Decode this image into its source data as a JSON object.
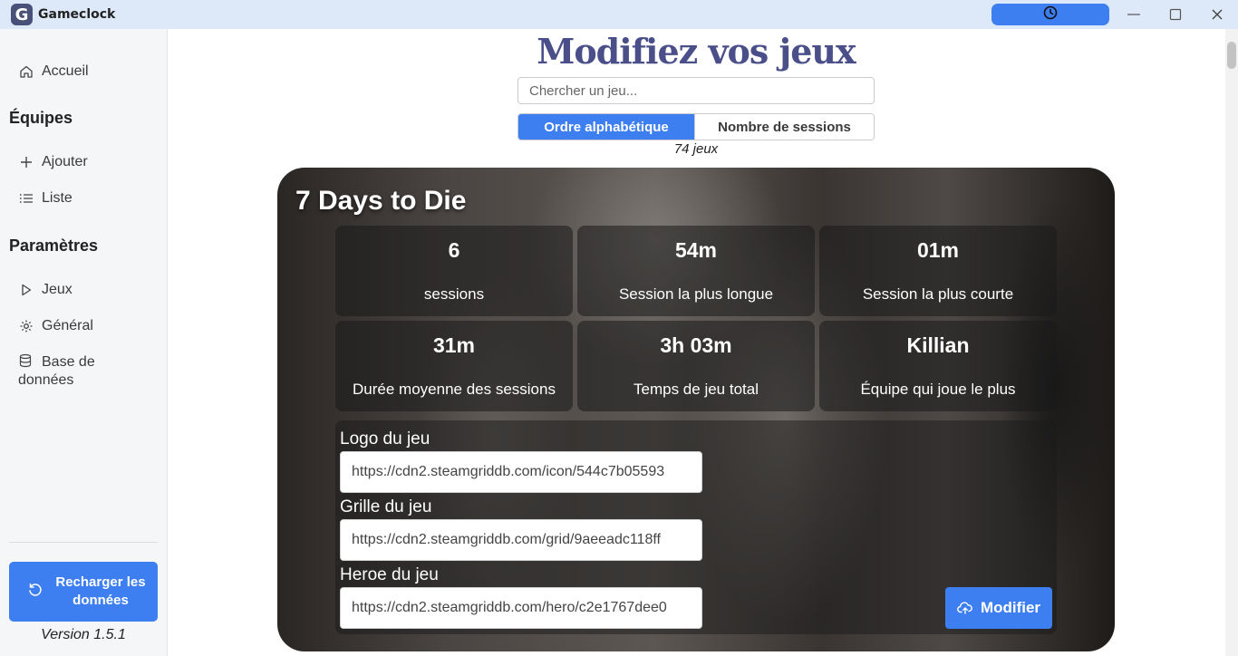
{
  "app": {
    "logo_letter": "G",
    "title": "Gameclock"
  },
  "window": {
    "minimize": "—",
    "maximize": "☐",
    "close": "✕"
  },
  "sidebar": {
    "home": "Accueil",
    "teams_title": "Équipes",
    "add": "Ajouter",
    "list": "Liste",
    "settings_title": "Paramètres",
    "games": "Jeux",
    "general": "Général",
    "database": "Base de données",
    "reload": "Recharger les données",
    "version": "Version 1.5.1"
  },
  "main": {
    "title": "Modifiez vos jeux",
    "search_placeholder": "Chercher un jeu...",
    "sort_alpha": "Ordre alphabétique",
    "sort_sessions": "Nombre de sessions",
    "count": "74 jeux"
  },
  "game": {
    "name": "7 Days to Die",
    "stats": [
      {
        "value": "6",
        "label": "sessions"
      },
      {
        "value": "54m",
        "label": "Session la plus longue"
      },
      {
        "value": "01m",
        "label": "Session la plus courte"
      },
      {
        "value": "31m",
        "label": "Durée moyenne des sessions"
      },
      {
        "value": "3h 03m",
        "label": "Temps de jeu total"
      },
      {
        "value": "Killian",
        "label": "Équipe qui joue le plus"
      }
    ],
    "logo_label": "Logo du jeu",
    "logo_value": "https://cdn2.steamgriddb.com/icon/544c7b05593",
    "grid_label": "Grille du jeu",
    "grid_value": "https://cdn2.steamgriddb.com/grid/9aeeadc118ff",
    "hero_label": "Heroe du jeu",
    "hero_value": "https://cdn2.steamgriddb.com/hero/c2e1767dee0",
    "modify": "Modifier"
  },
  "colors": {
    "accent": "#3d7ef0",
    "title": "#4a4f8a",
    "titlebar": "#dde8f8"
  }
}
